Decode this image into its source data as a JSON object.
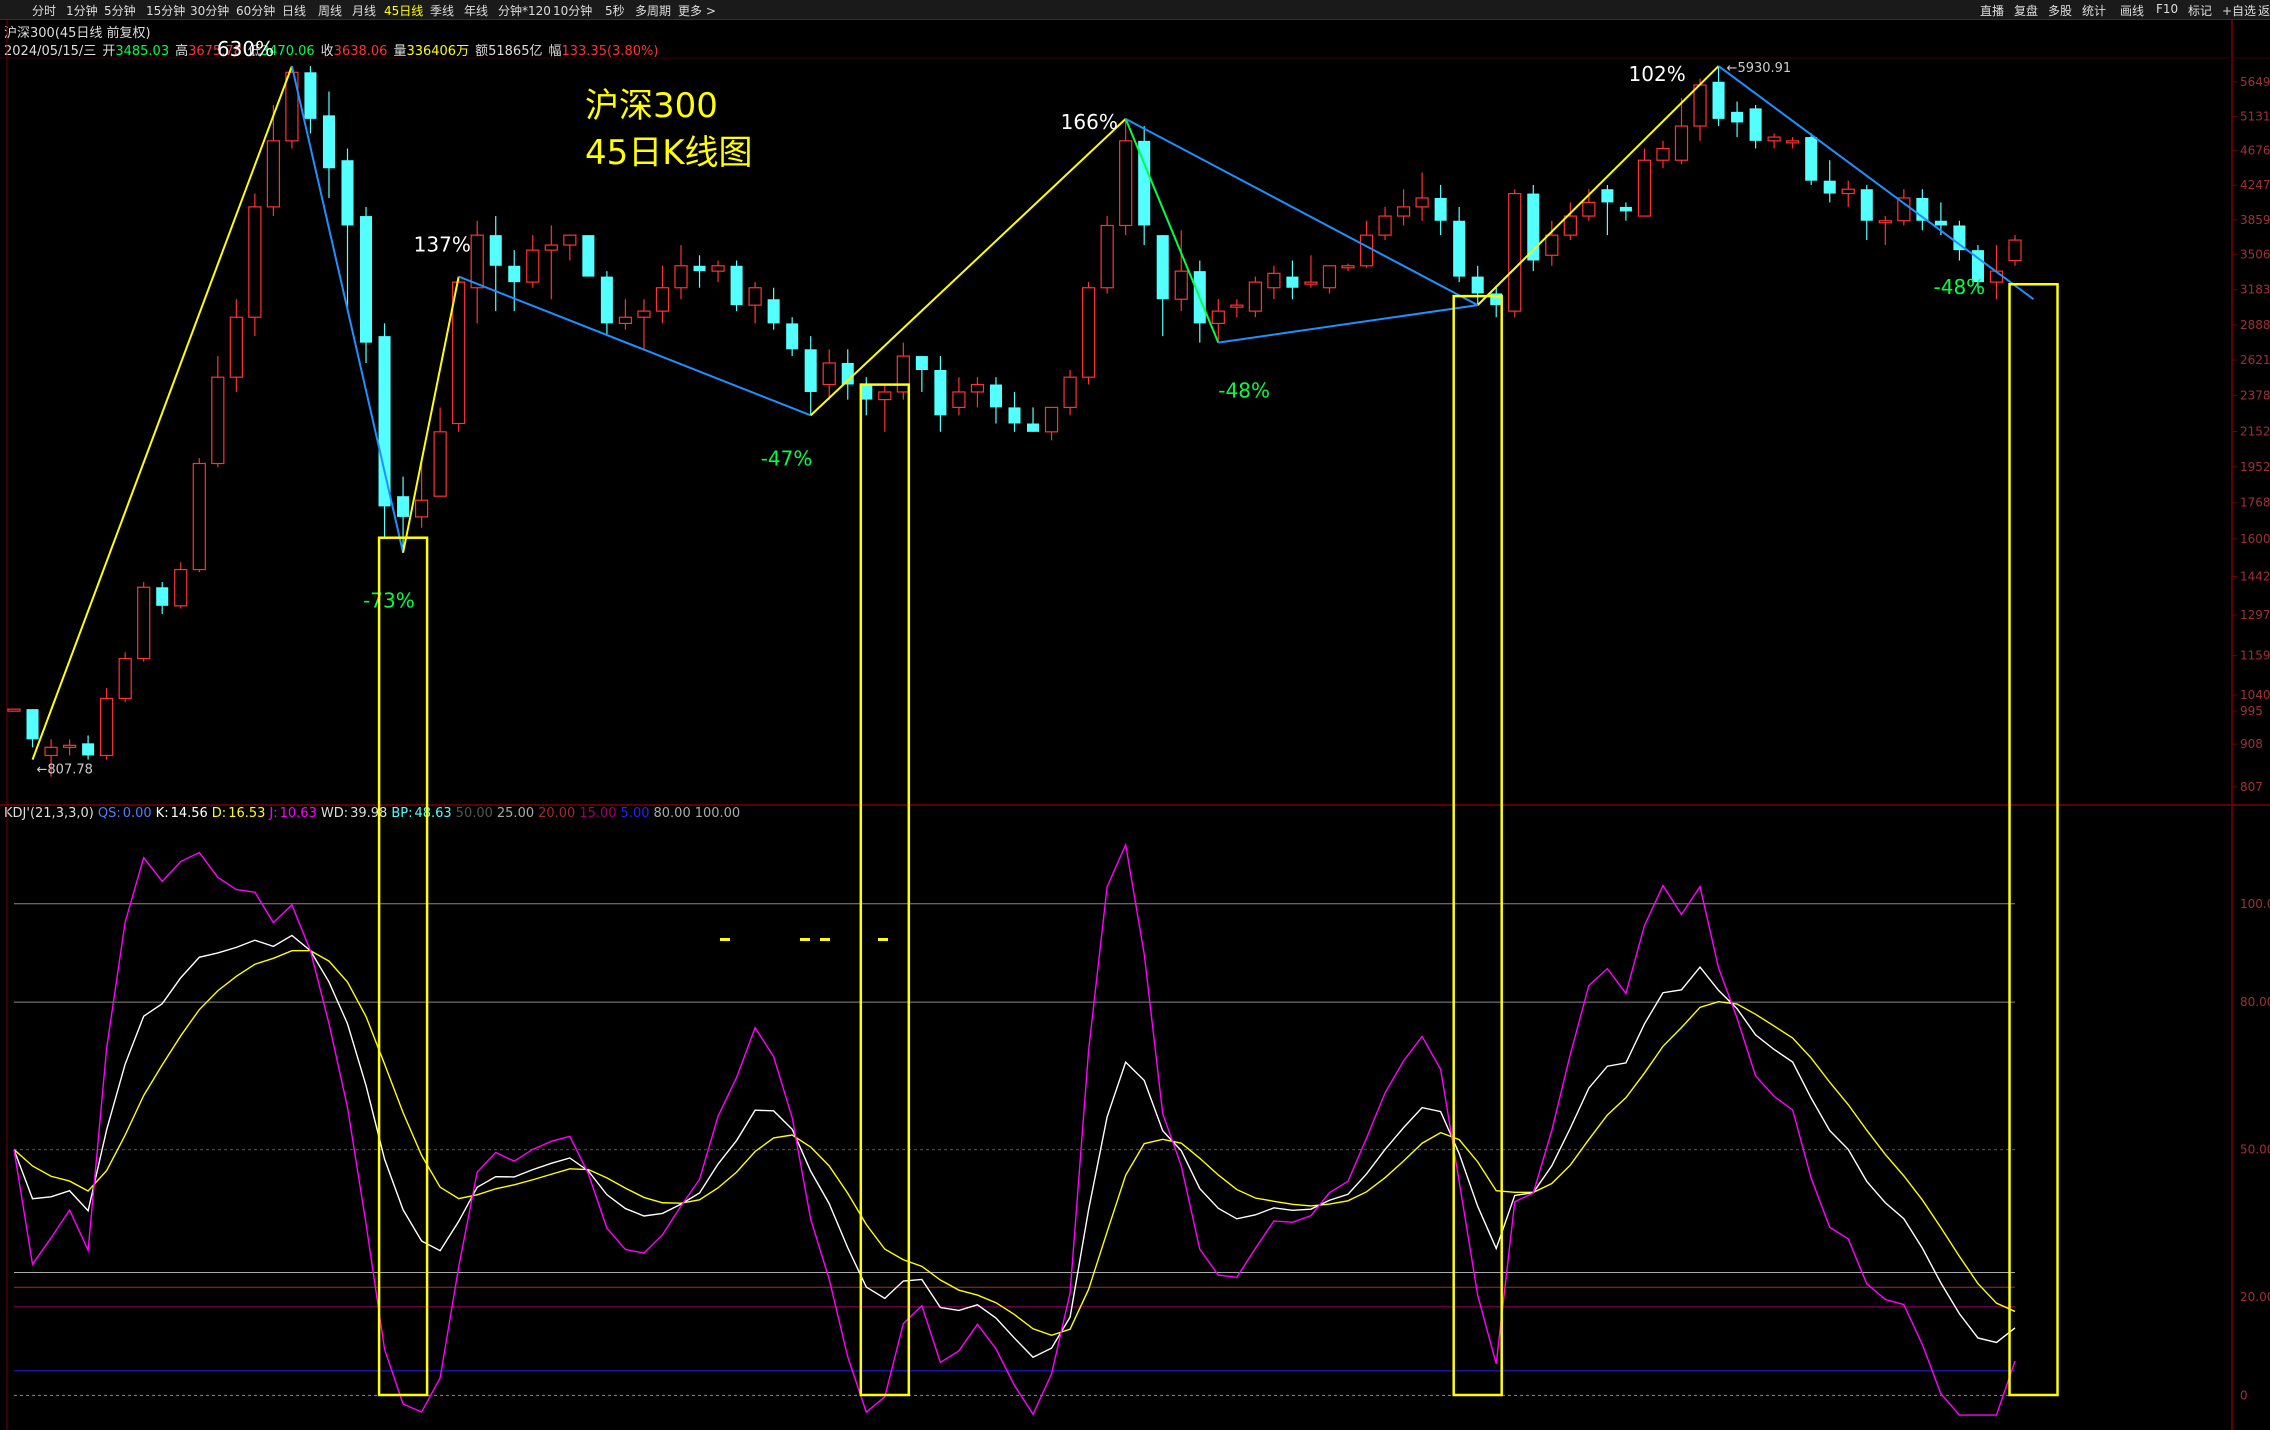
{
  "toolbar": {
    "left_items": [
      "分时",
      "1分钟",
      "5分钟",
      "15分钟",
      "30分钟",
      "60分钟",
      "日线",
      "周线",
      "月线",
      "45日线",
      "季线",
      "年线",
      "分钟*120",
      "10分钟",
      "5秒",
      "多周期",
      "更多 >"
    ],
    "active": "45日线",
    "right_items": [
      "直播",
      "复盘",
      "多股",
      "统计",
      "画线",
      "F10",
      "标记",
      "+自选",
      "返"
    ]
  },
  "header": {
    "title": "沪深300(45日线 前复权)",
    "date": "2024/05/15/三",
    "open_label": "开",
    "open": "3485.03",
    "high_label": "高",
    "high": "3675.78",
    "low_label": "低",
    "low": "3470.06",
    "close_label": "收",
    "close": "3638.06",
    "vol_label": "量",
    "vol": "336406万",
    "amt_label": "额",
    "amt": "51865亿",
    "chg_label": "幅",
    "chg": "133.35(3.80%)"
  },
  "annotation": {
    "line1": "沪深300",
    "line2": "45日K线图"
  },
  "colors": {
    "up": "#ff3232",
    "down": "#54ffff",
    "yellow": "#ffff00",
    "blue_line": "#1e90ff",
    "green_text": "#00ff44",
    "kdj_k": "#ffffff",
    "kdj_d": "#ffff00",
    "kdj_j": "#ff00ff"
  },
  "kdj_header": {
    "name": "KDJ'(21,3,3,0)",
    "qs_label": "QS:",
    "qs": "0.00",
    "k_label": "K:",
    "k": "14.56",
    "d_label": "D:",
    "d": "16.53",
    "j_label": "J:",
    "j": "10.63",
    "wd_label": "WD:",
    "wd": "39.98",
    "bp_label": "BP:",
    "bp": "48.63",
    "levels": [
      "50.00",
      "25.00",
      "20.00",
      "15.00",
      "5.00",
      "80.00",
      "100.00"
    ]
  },
  "chart_data": {
    "type": "candlestick",
    "price_axis_ticks": [
      "5649",
      "5131",
      "4676",
      "4247",
      "3859",
      "3506",
      "3183",
      "2888",
      "2621",
      "2378",
      "2152",
      "1952",
      "1768",
      "1600",
      "1442",
      "1297",
      "1159",
      "1040",
      "995",
      "908",
      "807"
    ],
    "extreme_labels": {
      "high": "5930.91",
      "low": "807.78"
    },
    "swing_labels": [
      {
        "text": "630%",
        "color": "white"
      },
      {
        "text": "-73%",
        "color": "green"
      },
      {
        "text": "137%",
        "color": "white"
      },
      {
        "text": "-47%",
        "color": "green"
      },
      {
        "text": "166%",
        "color": "white"
      },
      {
        "text": "-48%",
        "color": "green"
      },
      {
        "text": "102%",
        "color": "white"
      },
      {
        "text": "-48%",
        "color": "green"
      }
    ],
    "kdj_axis_ticks": [
      "100.00",
      "80.00",
      "50.00",
      "20.00",
      "0"
    ],
    "candles": [
      {
        "o": 1000,
        "c": 1000,
        "h": 1000,
        "l": 1000
      },
      {
        "o": 1000,
        "c": 920,
        "h": 1000,
        "l": 900
      },
      {
        "o": 880,
        "c": 900,
        "h": 920,
        "l": 830
      },
      {
        "o": 900,
        "c": 905,
        "h": 920,
        "l": 880
      },
      {
        "o": 910,
        "c": 880,
        "h": 930,
        "l": 870
      },
      {
        "o": 880,
        "c": 1030,
        "h": 1060,
        "l": 870
      },
      {
        "o": 1030,
        "c": 1150,
        "h": 1170,
        "l": 1020
      },
      {
        "o": 1150,
        "c": 1400,
        "h": 1420,
        "l": 1140
      },
      {
        "o": 1400,
        "c": 1330,
        "h": 1420,
        "l": 1300
      },
      {
        "o": 1330,
        "c": 1470,
        "h": 1500,
        "l": 1320
      },
      {
        "o": 1470,
        "c": 1970,
        "h": 2000,
        "l": 1460
      },
      {
        "o": 1970,
        "c": 2500,
        "h": 2650,
        "l": 1950
      },
      {
        "o": 2500,
        "c": 2950,
        "h": 3100,
        "l": 2400
      },
      {
        "o": 2950,
        "c": 4000,
        "h": 4150,
        "l": 2800
      },
      {
        "o": 4000,
        "c": 4800,
        "h": 5300,
        "l": 3900
      },
      {
        "o": 4800,
        "c": 5800,
        "h": 5900,
        "l": 4700
      },
      {
        "o": 5800,
        "c": 5100,
        "h": 5900,
        "l": 4900
      },
      {
        "o": 5150,
        "c": 4450,
        "h": 5500,
        "l": 4100
      },
      {
        "o": 4550,
        "c": 3800,
        "h": 4700,
        "l": 3000
      },
      {
        "o": 3900,
        "c": 2750,
        "h": 4000,
        "l": 2600
      },
      {
        "o": 2800,
        "c": 1750,
        "h": 2900,
        "l": 1600
      },
      {
        "o": 1800,
        "c": 1700,
        "h": 1900,
        "l": 1540
      },
      {
        "o": 1700,
        "c": 1780,
        "h": 2000,
        "l": 1650
      },
      {
        "o": 1800,
        "c": 2150,
        "h": 2300,
        "l": 1800
      },
      {
        "o": 2200,
        "c": 3250,
        "h": 3300,
        "l": 2150
      },
      {
        "o": 3200,
        "c": 3700,
        "h": 3850,
        "l": 2900
      },
      {
        "o": 3700,
        "c": 3400,
        "h": 3900,
        "l": 3000
      },
      {
        "o": 3400,
        "c": 3250,
        "h": 3550,
        "l": 3000
      },
      {
        "o": 3250,
        "c": 3550,
        "h": 3700,
        "l": 3200
      },
      {
        "o": 3550,
        "c": 3600,
        "h": 3800,
        "l": 3100
      },
      {
        "o": 3600,
        "c": 3700,
        "h": 3700,
        "l": 3450
      },
      {
        "o": 3700,
        "c": 3300,
        "h": 3700,
        "l": 3300
      },
      {
        "o": 3300,
        "c": 2900,
        "h": 3350,
        "l": 2800
      },
      {
        "o": 2900,
        "c": 2950,
        "h": 3100,
        "l": 2850
      },
      {
        "o": 2950,
        "c": 3000,
        "h": 3100,
        "l": 2700
      },
      {
        "o": 3000,
        "c": 3200,
        "h": 3400,
        "l": 2900
      },
      {
        "o": 3200,
        "c": 3400,
        "h": 3600,
        "l": 3100
      },
      {
        "o": 3400,
        "c": 3350,
        "h": 3500,
        "l": 3200
      },
      {
        "o": 3350,
        "c": 3400,
        "h": 3450,
        "l": 3250
      },
      {
        "o": 3400,
        "c": 3050,
        "h": 3450,
        "l": 3000
      },
      {
        "o": 3050,
        "c": 3200,
        "h": 3250,
        "l": 2900
      },
      {
        "o": 3100,
        "c": 2900,
        "h": 3200,
        "l": 2850
      },
      {
        "o": 2900,
        "c": 2700,
        "h": 2950,
        "l": 2650
      },
      {
        "o": 2700,
        "c": 2400,
        "h": 2800,
        "l": 2250
      },
      {
        "o": 2450,
        "c": 2600,
        "h": 2700,
        "l": 2350
      },
      {
        "o": 2600,
        "c": 2450,
        "h": 2700,
        "l": 2350
      },
      {
        "o": 2450,
        "c": 2350,
        "h": 2500,
        "l": 2250
      },
      {
        "o": 2350,
        "c": 2400,
        "h": 2450,
        "l": 2150
      },
      {
        "o": 2400,
        "c": 2650,
        "h": 2750,
        "l": 2350
      },
      {
        "o": 2650,
        "c": 2550,
        "h": 2650,
        "l": 2400
      },
      {
        "o": 2550,
        "c": 2250,
        "h": 2650,
        "l": 2150
      },
      {
        "o": 2300,
        "c": 2400,
        "h": 2500,
        "l": 2250
      },
      {
        "o": 2400,
        "c": 2450,
        "h": 2500,
        "l": 2300
      },
      {
        "o": 2450,
        "c": 2300,
        "h": 2500,
        "l": 2200
      },
      {
        "o": 2300,
        "c": 2200,
        "h": 2400,
        "l": 2150
      },
      {
        "o": 2200,
        "c": 2150,
        "h": 2300,
        "l": 2150
      },
      {
        "o": 2150,
        "c": 2300,
        "h": 2300,
        "l": 2100
      },
      {
        "o": 2300,
        "c": 2500,
        "h": 2550,
        "l": 2250
      },
      {
        "o": 2500,
        "c": 3200,
        "h": 3250,
        "l": 2450
      },
      {
        "o": 3200,
        "c": 3800,
        "h": 3900,
        "l": 3150
      },
      {
        "o": 3800,
        "c": 4800,
        "h": 5100,
        "l": 3700
      },
      {
        "o": 4800,
        "c": 3800,
        "h": 5000,
        "l": 3600
      },
      {
        "o": 3700,
        "c": 3100,
        "h": 3700,
        "l": 2800
      },
      {
        "o": 3100,
        "c": 3350,
        "h": 3750,
        "l": 3000
      },
      {
        "o": 3350,
        "c": 2900,
        "h": 3450,
        "l": 2750
      },
      {
        "o": 2900,
        "c": 3000,
        "h": 3100,
        "l": 2750
      },
      {
        "o": 3050,
        "c": 3050,
        "h": 3100,
        "l": 2950
      },
      {
        "o": 3000,
        "c": 3250,
        "h": 3300,
        "l": 2950
      },
      {
        "o": 3200,
        "c": 3330,
        "h": 3400,
        "l": 3100
      },
      {
        "o": 3300,
        "c": 3200,
        "h": 3450,
        "l": 3100
      },
      {
        "o": 3250,
        "c": 3250,
        "h": 3500,
        "l": 3200
      },
      {
        "o": 3200,
        "c": 3400,
        "h": 3400,
        "l": 3150
      },
      {
        "o": 3400,
        "c": 3400,
        "h": 3420,
        "l": 3350
      },
      {
        "o": 3400,
        "c": 3700,
        "h": 3850,
        "l": 3380
      },
      {
        "o": 3700,
        "c": 3900,
        "h": 4000,
        "l": 3650
      },
      {
        "o": 3900,
        "c": 4000,
        "h": 4200,
        "l": 3800
      },
      {
        "o": 4000,
        "c": 4100,
        "h": 4400,
        "l": 3850
      },
      {
        "o": 4100,
        "c": 3850,
        "h": 4250,
        "l": 3700
      },
      {
        "o": 3850,
        "c": 3300,
        "h": 4000,
        "l": 3250
      },
      {
        "o": 3300,
        "c": 3150,
        "h": 3400,
        "l": 3050
      },
      {
        "o": 3150,
        "c": 3050,
        "h": 3200,
        "l": 2950
      },
      {
        "o": 3000,
        "c": 4150,
        "h": 4200,
        "l": 2950
      },
      {
        "o": 4150,
        "c": 3450,
        "h": 4250,
        "l": 3350
      },
      {
        "o": 3500,
        "c": 3700,
        "h": 3850,
        "l": 3400
      },
      {
        "o": 3700,
        "c": 3900,
        "h": 4050,
        "l": 3650
      },
      {
        "o": 3900,
        "c": 4050,
        "h": 4200,
        "l": 3850
      },
      {
        "o": 4200,
        "c": 4050,
        "h": 4250,
        "l": 3700
      },
      {
        "o": 4000,
        "c": 3950,
        "h": 4050,
        "l": 3850
      },
      {
        "o": 3900,
        "c": 4550,
        "h": 4700,
        "l": 3900
      },
      {
        "o": 4550,
        "c": 4700,
        "h": 4800,
        "l": 4450
      },
      {
        "o": 4550,
        "c": 5000,
        "h": 5400,
        "l": 4500
      },
      {
        "o": 5000,
        "c": 5600,
        "h": 5700,
        "l": 4800
      },
      {
        "o": 5650,
        "c": 5100,
        "h": 5900,
        "l": 5000
      },
      {
        "o": 5200,
        "c": 5050,
        "h": 5350,
        "l": 4850
      },
      {
        "o": 5250,
        "c": 4800,
        "h": 5300,
        "l": 4700
      },
      {
        "o": 4800,
        "c": 4850,
        "h": 4900,
        "l": 4700
      },
      {
        "o": 4800,
        "c": 4800,
        "h": 4850,
        "l": 4700
      },
      {
        "o": 4850,
        "c": 4300,
        "h": 4900,
        "l": 4250
      },
      {
        "o": 4300,
        "c": 4150,
        "h": 4550,
        "l": 4050
      },
      {
        "o": 4150,
        "c": 4200,
        "h": 4300,
        "l": 4000
      },
      {
        "o": 4200,
        "c": 3850,
        "h": 4250,
        "l": 3650
      },
      {
        "o": 3850,
        "c": 3850,
        "h": 3900,
        "l": 3600
      },
      {
        "o": 3850,
        "c": 4100,
        "h": 4200,
        "l": 3800
      },
      {
        "o": 4100,
        "c": 3850,
        "h": 4200,
        "l": 3750
      },
      {
        "o": 3850,
        "c": 3800,
        "h": 4050,
        "l": 3700
      },
      {
        "o": 3800,
        "c": 3550,
        "h": 3850,
        "l": 3450
      },
      {
        "o": 3550,
        "c": 3250,
        "h": 3600,
        "l": 3200
      },
      {
        "o": 3250,
        "c": 3350,
        "h": 3600,
        "l": 3100
      },
      {
        "o": 3450,
        "c": 3650,
        "h": 3700,
        "l": 3400
      }
    ]
  }
}
